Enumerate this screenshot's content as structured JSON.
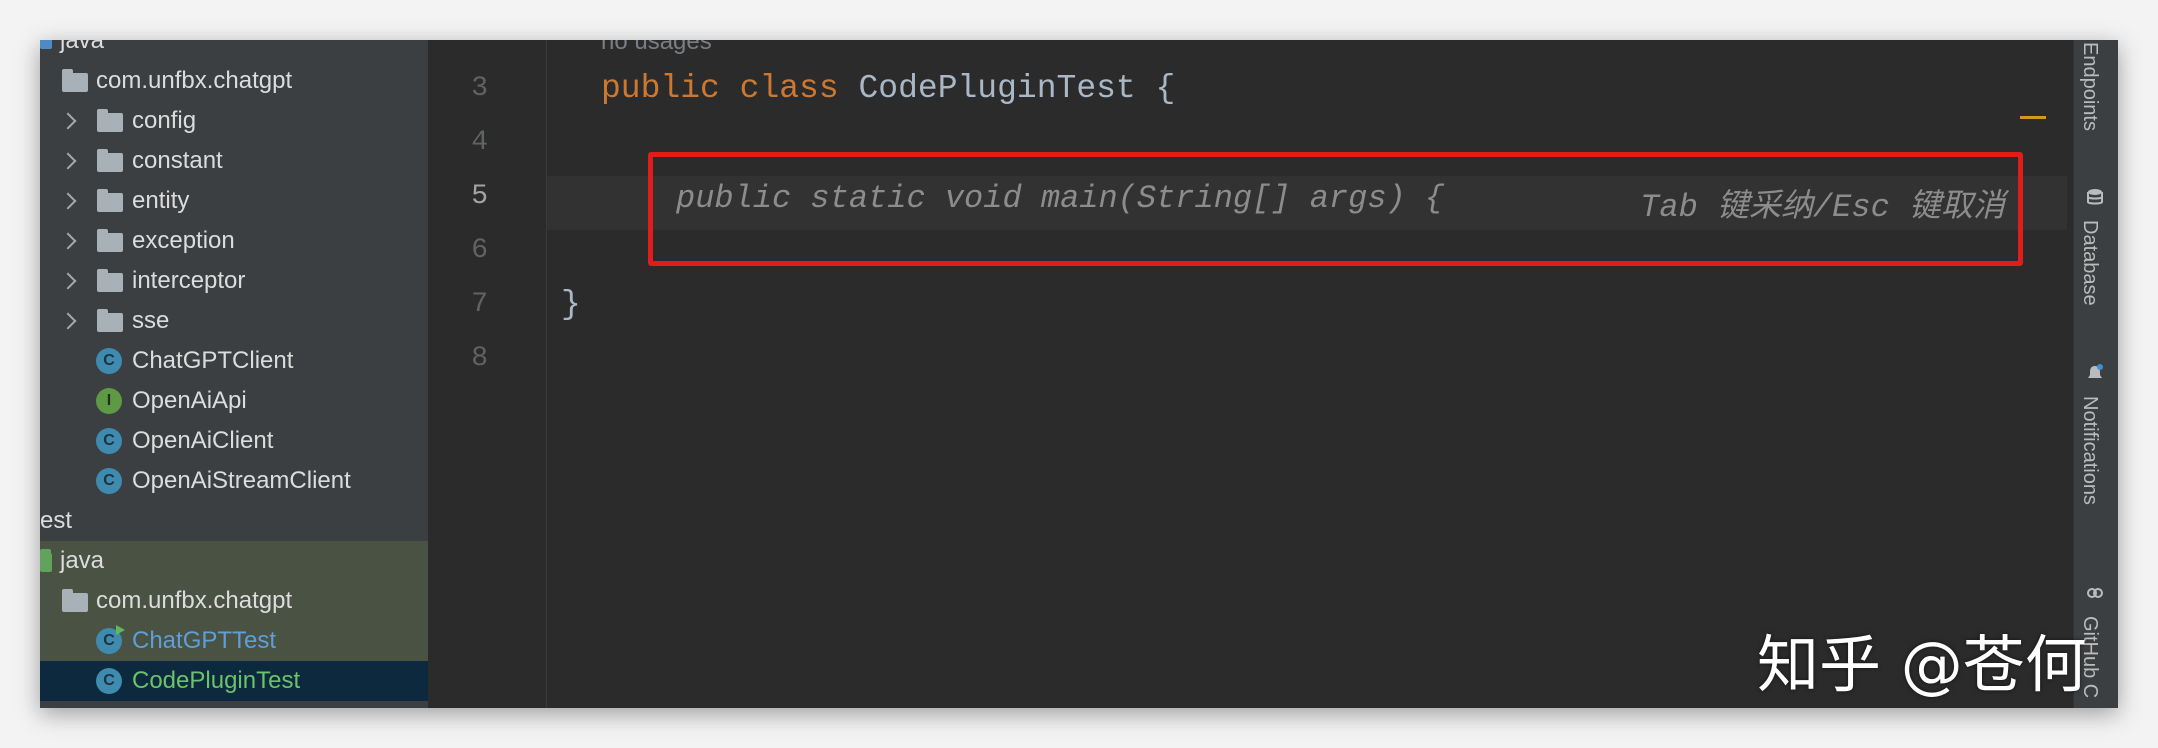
{
  "project_tree": {
    "items": [
      {
        "label": "java"
      },
      {
        "label": "com.unfbx.chatgpt"
      },
      {
        "label": "config"
      },
      {
        "label": "constant"
      },
      {
        "label": "entity"
      },
      {
        "label": "exception"
      },
      {
        "label": "interceptor"
      },
      {
        "label": "sse"
      },
      {
        "label": "ChatGPTClient",
        "icon_letter": "C"
      },
      {
        "label": "OpenAiApi",
        "icon_letter": "I"
      },
      {
        "label": "OpenAiClient",
        "icon_letter": "C"
      },
      {
        "label": "OpenAiStreamClient",
        "icon_letter": "C"
      },
      {
        "label": "est"
      },
      {
        "label": "java"
      },
      {
        "label": "com.unfbx.chatgpt"
      },
      {
        "label": "ChatGPTTest",
        "icon_letter": "C"
      },
      {
        "label": "CodePluginTest",
        "icon_letter": "C"
      }
    ]
  },
  "editor": {
    "line_numbers": [
      "3",
      "4",
      "5",
      "6",
      "7",
      "8"
    ],
    "active_line": "5",
    "usages_hint": "no usages",
    "code": {
      "line3_kw1": "public",
      "line3_kw2": "class",
      "line3_name": "CodePluginTest",
      "line3_brace": "{",
      "line7": "}"
    },
    "suggestion": {
      "text": "public static void main(String[] args) {",
      "hint": "Tab 键采纳/Esc 键取消"
    }
  },
  "right_toolbar": {
    "tabs": [
      {
        "label": "Endpoints",
        "icon": "endpoints-icon"
      },
      {
        "label": "Database",
        "icon": "database-icon"
      },
      {
        "label": "Notifications",
        "icon": "bell-icon"
      },
      {
        "label": "GitHub C",
        "icon": "copilot-icon"
      }
    ]
  },
  "watermark": "知乎 @苍何",
  "colors": {
    "keyword": "#cc7832",
    "code_text": "#a9b7c6",
    "highlight_box": "#e01c1c",
    "editor_bg": "#2b2b2b",
    "sidebar_bg": "#3c3f41",
    "selection_bg": "#0d293e"
  }
}
